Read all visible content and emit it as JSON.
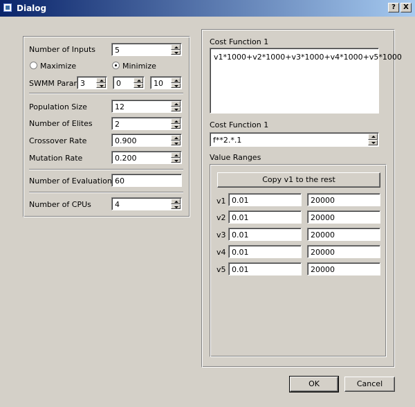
{
  "window": {
    "title": "Dialog",
    "help_label": "?",
    "close_label": "X"
  },
  "left": {
    "num_inputs": {
      "label": "Number of Inputs",
      "value": "5"
    },
    "maximize": {
      "label": "Maximize",
      "checked": false
    },
    "minimize": {
      "label": "Minimize",
      "checked": true
    },
    "swmm": {
      "label": "SWMM Param",
      "values": [
        "3",
        "0",
        "10"
      ]
    },
    "population": {
      "label": "Population Size",
      "value": "12"
    },
    "elites": {
      "label": "Number of Elites",
      "value": "2"
    },
    "crossover": {
      "label": "Crossover Rate",
      "value": "0.900"
    },
    "mutation": {
      "label": "Mutation Rate",
      "value": "0.200"
    },
    "evaluations": {
      "label": "Number of Evaluations",
      "value": "60"
    },
    "cpus": {
      "label": "Number of CPUs",
      "value": "4"
    }
  },
  "right": {
    "cost_label_1": "Cost Function 1",
    "cost_expression": "v1*1000+v2*1000+v3*1000+v4*1000+v5*1000",
    "cost_label_2": "Cost Function 1",
    "cost_combo": "f**2.*.1",
    "value_ranges_label": "Value Ranges",
    "copy_button": "Copy  v1  to the rest",
    "ranges": [
      {
        "name": "v1",
        "min": "0.01",
        "max": "20000"
      },
      {
        "name": "v2",
        "min": "0.01",
        "max": "20000"
      },
      {
        "name": "v3",
        "min": "0.01",
        "max": "20000"
      },
      {
        "name": "v4",
        "min": "0.01",
        "max": "20000"
      },
      {
        "name": "v5",
        "min": "0.01",
        "max": "20000"
      }
    ]
  },
  "buttons": {
    "ok": "OK",
    "cancel": "Cancel"
  }
}
